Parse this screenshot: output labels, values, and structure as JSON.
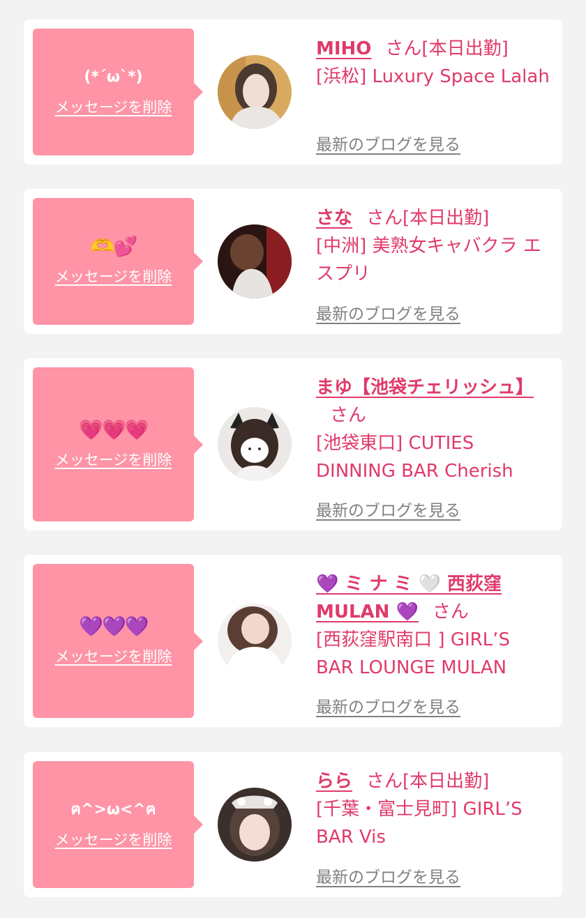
{
  "colors": {
    "pink_bubble": "#fe94a6",
    "name_pink": "#e03a6a",
    "muted_gray": "#808080",
    "page_bg": "#f3f3f3"
  },
  "delete_label": "メッセージを削除",
  "blog_label": "最新のブログを見る",
  "cards": [
    {
      "message": "(*´ω`*)",
      "name": "MIHO",
      "suffix": "さん[本日出勤]",
      "shop": "[浜松] Luxury Space Lalah"
    },
    {
      "message": "🫶💕",
      "name": "さな",
      "suffix": "さん[本日出勤]",
      "shop": "[中洲] 美熟女キャバクラ エスプリ"
    },
    {
      "message": "💗💗💗",
      "name": "まゆ【池袋チェリッシュ】",
      "suffix": "さん",
      "shop": "[池袋東口] CUTIES DINNING BAR Cherish"
    },
    {
      "message": "💜💜💜",
      "name": "💜 ミ ナ ミ 🤍 西荻窪 MULAN 💜",
      "suffix": "さん",
      "shop": "[西荻窪駅南口 ] GIRL’S BAR LOUNGE MULAN"
    },
    {
      "message": "ฅ^>ω<^ฅ",
      "name": "らら",
      "suffix": "さん[本日出勤]",
      "shop": "[千葉・富士見町] GIRL’S BAR Vis"
    }
  ]
}
